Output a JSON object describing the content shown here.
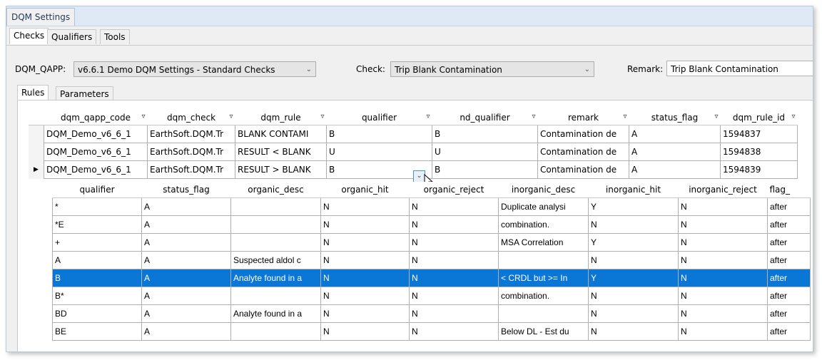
{
  "window": {
    "doc_tab": "DQM Settings"
  },
  "tabs": {
    "checks": "Checks",
    "qualifiers": "Qualifiers",
    "tools": "Tools"
  },
  "filters": {
    "qapp_label": "DQM_QAPP:",
    "qapp_value": "v6.6.1 Demo DQM Settings - Standard Checks",
    "check_label": "Check:",
    "check_value": "Trip Blank Contamination",
    "remark_label": "Remark:",
    "remark_value": "Trip Blank Contamination"
  },
  "inner_tabs": {
    "rules": "Rules",
    "parameters": "Parameters"
  },
  "rules_grid": {
    "columns": [
      "dqm_qapp_code",
      "dqm_check",
      "dqm_rule",
      "qualifier",
      "nd_qualifier",
      "remark",
      "status_flag",
      "dqm_rule_id"
    ],
    "rows": [
      [
        "DQM_Demo_v6_6_1",
        "EarthSoft.DQM.Tr",
        "BLANK CONTAMI",
        "B",
        "B",
        "Contamination de",
        "A",
        "1594837"
      ],
      [
        "DQM_Demo_v6_6_1",
        "EarthSoft.DQM.Tr",
        "RESULT < BLANK",
        "U",
        "U",
        "Contamination de",
        "A",
        "1594838"
      ],
      [
        "DQM_Demo_v6_6_1",
        "EarthSoft.DQM.Tr",
        "RESULT > BLANK",
        "B",
        "B",
        "Contamination de",
        "A",
        "1594839"
      ]
    ],
    "current_row_marker": "▶"
  },
  "qualifier_dropdown": {
    "columns": [
      "qualifier",
      "status_flag",
      "organic_desc",
      "organic_hit",
      "organic_reject",
      "inorganic_desc",
      "inorganic_hit",
      "inorganic_reject",
      "flag_"
    ],
    "rows": [
      [
        "*",
        "A",
        "",
        "N",
        "N",
        "Duplicate analysi",
        "Y",
        "N",
        "after"
      ],
      [
        "*E",
        "A",
        "",
        "N",
        "N",
        "combination.",
        "N",
        "N",
        "after"
      ],
      [
        "+",
        "A",
        "",
        "N",
        "N",
        "MSA Correlation",
        "Y",
        "N",
        "after"
      ],
      [
        "A",
        "A",
        "Suspected aldol c",
        "N",
        "N",
        "",
        "N",
        "N",
        "after"
      ],
      [
        "B",
        "A",
        "Analyte found in a",
        "N",
        "N",
        "< CRDL but >= In",
        "Y",
        "N",
        "after"
      ],
      [
        "B*",
        "A",
        "",
        "N",
        "N",
        "combination.",
        "N",
        "N",
        "after"
      ],
      [
        "BD",
        "A",
        "Analyte found in a",
        "N",
        "N",
        "",
        "N",
        "N",
        "after"
      ],
      [
        "BE",
        "A",
        "",
        "N",
        "N",
        "Below DL - Est du",
        "N",
        "N",
        "after"
      ]
    ],
    "highlighted_index": 4
  },
  "icons": {
    "filter": "funnel-icon",
    "dropdown": "chevron-down-icon",
    "cursor": "mouse-pointer-icon"
  },
  "colors": {
    "selection": "#0a77d7",
    "doc_tab_text": "#1e395b"
  }
}
